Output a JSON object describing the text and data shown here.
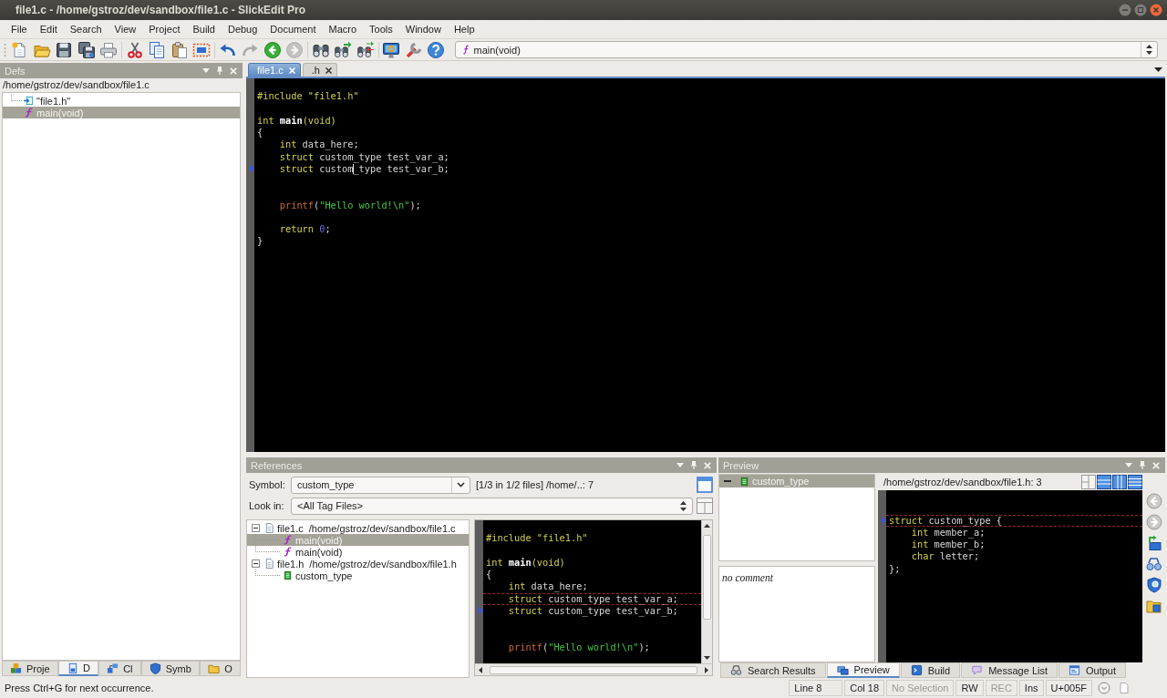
{
  "window": {
    "title": "file1.c - /home/gstroz/dev/sandbox/file1.c - SlickEdit Pro"
  },
  "menu": [
    "File",
    "Edit",
    "Search",
    "View",
    "Project",
    "Build",
    "Debug",
    "Document",
    "Macro",
    "Tools",
    "Window",
    "Help"
  ],
  "toolbar_groups": [
    [
      {
        "kind": "new",
        "disabled": false
      },
      {
        "kind": "open",
        "disabled": false
      },
      {
        "kind": "save",
        "disabled": false
      },
      {
        "kind": "save-all",
        "disabled": false
      },
      {
        "kind": "print",
        "disabled": false
      }
    ],
    [
      {
        "kind": "cut",
        "disabled": false
      },
      {
        "kind": "copy",
        "disabled": false
      },
      {
        "kind": "paste",
        "disabled": false
      },
      {
        "kind": "select",
        "disabled": false
      }
    ],
    [
      {
        "kind": "undo",
        "disabled": false
      },
      {
        "kind": "redo",
        "disabled": true
      },
      {
        "kind": "back",
        "disabled": false
      },
      {
        "kind": "forward",
        "disabled": true
      }
    ],
    [
      {
        "kind": "find",
        "disabled": false
      },
      {
        "kind": "find-next",
        "disabled": false
      },
      {
        "kind": "replace",
        "disabled": false
      }
    ],
    [
      {
        "kind": "monitor",
        "disabled": false
      },
      {
        "kind": "tools",
        "disabled": false
      },
      {
        "kind": "help",
        "disabled": false
      }
    ]
  ],
  "context_combo": {
    "value": "main(void)"
  },
  "defs_panel": {
    "title": "Defs",
    "path": "/home/gstroz/dev/sandbox/file1.c",
    "items": [
      {
        "label": "\"file1.h\"",
        "kind": "include",
        "selected": false
      },
      {
        "label": "main(void)",
        "kind": "function",
        "selected": true
      }
    ],
    "tabs": [
      {
        "label": "Proje",
        "kind": "projects",
        "selected": false
      },
      {
        "label": "D",
        "kind": "defs",
        "selected": true
      },
      {
        "label": "Cl",
        "kind": "classes",
        "selected": false
      },
      {
        "label": "Symb",
        "kind": "symbols",
        "selected": false
      },
      {
        "label": "O",
        "kind": "open",
        "selected": false
      }
    ]
  },
  "editor": {
    "tabs": [
      {
        "label": "file1.c",
        "selected": true
      },
      {
        "label": ".h",
        "selected": false
      }
    ],
    "lines": [
      {
        "marked": false,
        "current": false
      },
      {
        "marked": false,
        "current": false,
        "indented": false,
        "tokens": [
          {
            "kind": "preprocessor",
            "text": "#include \"file1.h\""
          }
        ]
      },
      {
        "marked": false,
        "current": false
      },
      {
        "marked": false,
        "current": false,
        "indented": false,
        "tokens": [
          {
            "kind": "keyword",
            "text": "int "
          },
          {
            "kind": "function",
            "text": "main"
          },
          {
            "kind": "keyword",
            "text": "(void)"
          }
        ]
      },
      {
        "marked": false,
        "current": false,
        "indented": false,
        "tokens": [
          {
            "kind": "plain",
            "text": "{"
          }
        ]
      },
      {
        "marked": false,
        "current": false,
        "indented": true,
        "tokens": [
          {
            "kind": "keyword",
            "text": "int"
          },
          {
            "kind": "plain",
            "text": " data_here;"
          }
        ]
      },
      {
        "marked": false,
        "current": false,
        "indented": true,
        "tokens": [
          {
            "kind": "keyword",
            "text": "struct"
          },
          {
            "kind": "plain",
            "text": " custom_type test_var_a;"
          }
        ]
      },
      {
        "marked": true,
        "current": false,
        "indented": true,
        "tokens": [
          {
            "kind": "keyword",
            "text": "struct"
          },
          {
            "kind": "plain",
            "text": " custom"
          },
          {
            "kind": "caret"
          },
          {
            "kind": "plain",
            "text": "_type test_var_b;"
          }
        ]
      },
      {
        "marked": false,
        "current": false
      },
      {
        "marked": false,
        "current": false
      },
      {
        "marked": false,
        "current": false,
        "indented": true,
        "tokens": [
          {
            "kind": "call",
            "text": "printf"
          },
          {
            "kind": "plain",
            "text": "("
          },
          {
            "kind": "string",
            "text": "\"Hello world!\\n\""
          },
          {
            "kind": "plain",
            "text": ");"
          }
        ]
      },
      {
        "marked": false,
        "current": false
      },
      {
        "marked": false,
        "current": false,
        "indented": true,
        "tokens": [
          {
            "kind": "keyword",
            "text": "return "
          },
          {
            "kind": "number",
            "text": "0"
          },
          {
            "kind": "plain",
            "text": ";"
          }
        ]
      },
      {
        "marked": false,
        "current": false,
        "indented": false,
        "tokens": [
          {
            "kind": "plain",
            "text": "}"
          }
        ]
      }
    ]
  },
  "references": {
    "title": "References",
    "symbol_label": "Symbol:",
    "symbol": "custom_type",
    "match_info": "[1/3 in 1/2 files] /home/..: 7",
    "look_in_label": "Look in:",
    "look_in": "<All Tag Files>",
    "tree": [
      {
        "label": "file1.c",
        "path": "/home/gstroz/dev/sandbox/file1.c",
        "kind": "file",
        "selected": false,
        "expanded": true,
        "children": [
          {
            "label": "main(void)",
            "kind": "function",
            "selected": true
          },
          {
            "label": "main(void)",
            "kind": "function",
            "selected": false
          }
        ]
      },
      {
        "label": "file1.h",
        "path": "/home/gstroz/dev/sandbox/file1.h",
        "kind": "file",
        "selected": false,
        "expanded": true,
        "children": [
          {
            "label": "custom_type",
            "kind": "struct",
            "selected": false
          }
        ]
      }
    ],
    "lines": [
      {
        "marked": false,
        "current": false
      },
      {
        "marked": false,
        "current": false,
        "indented": false,
        "tokens": [
          {
            "kind": "preprocessor",
            "text": "#include \"file1.h\""
          }
        ]
      },
      {
        "marked": false,
        "current": false
      },
      {
        "marked": false,
        "current": false,
        "indented": false,
        "tokens": [
          {
            "kind": "keyword",
            "text": "int "
          },
          {
            "kind": "function",
            "text": "main"
          },
          {
            "kind": "keyword",
            "text": "(void)"
          }
        ]
      },
      {
        "marked": false,
        "current": false,
        "indented": false,
        "tokens": [
          {
            "kind": "plain",
            "text": "{"
          }
        ]
      },
      {
        "marked": false,
        "current": false,
        "indented": true,
        "tokens": [
          {
            "kind": "keyword",
            "text": "int"
          },
          {
            "kind": "plain",
            "text": " data_here;"
          }
        ]
      },
      {
        "marked": false,
        "current": true,
        "indented": true,
        "tokens": [
          {
            "kind": "keyword",
            "text": "struct"
          },
          {
            "kind": "plain",
            "text": " custom_type test_var_a;"
          }
        ]
      },
      {
        "marked": true,
        "current": false,
        "indented": true,
        "tokens": [
          {
            "kind": "keyword",
            "text": "struct"
          },
          {
            "kind": "plain",
            "text": " custom_type test_var_b;"
          }
        ]
      },
      {
        "marked": false,
        "current": false
      },
      {
        "marked": false,
        "current": false
      },
      {
        "marked": false,
        "current": false,
        "indented": true,
        "tokens": [
          {
            "kind": "call",
            "text": "printf"
          },
          {
            "kind": "plain",
            "text": "("
          },
          {
            "kind": "string",
            "text": "\"Hello world!\\n\""
          },
          {
            "kind": "plain",
            "text": ");"
          }
        ]
      }
    ]
  },
  "preview": {
    "title": "Preview",
    "tree": [
      {
        "label": "custom_type",
        "kind": "struct",
        "selected": true,
        "expanded": true
      }
    ],
    "comment": "no comment",
    "path": "/home/gstroz/dev/sandbox/file1.h: 3",
    "lines": [
      {
        "marked": false,
        "current": false
      },
      {
        "marked": false,
        "current": false
      },
      {
        "marked": true,
        "current": true,
        "indented": false,
        "tokens": [
          {
            "kind": "keyword",
            "text": "struct"
          },
          {
            "kind": "plain",
            "text": " custom_type {"
          }
        ]
      },
      {
        "marked": false,
        "current": false,
        "indented": true,
        "tokens": [
          {
            "kind": "keyword",
            "text": "int"
          },
          {
            "kind": "plain",
            "text": " member_a;"
          }
        ]
      },
      {
        "marked": false,
        "current": false,
        "indented": true,
        "tokens": [
          {
            "kind": "keyword",
            "text": "int"
          },
          {
            "kind": "plain",
            "text": " member_b;"
          }
        ]
      },
      {
        "marked": false,
        "current": false,
        "indented": true,
        "tokens": [
          {
            "kind": "keyword",
            "text": "char"
          },
          {
            "kind": "plain",
            "text": " letter;"
          }
        ]
      },
      {
        "marked": false,
        "current": false,
        "indented": false,
        "tokens": [
          {
            "kind": "plain",
            "text": "};"
          }
        ]
      }
    ]
  },
  "bottom_tabs": [
    {
      "label": "Search Results",
      "kind": "search",
      "selected": false
    },
    {
      "label": "Preview",
      "kind": "preview",
      "selected": true
    },
    {
      "label": "Build",
      "kind": "build",
      "selected": false
    },
    {
      "label": "Message List",
      "kind": "messages",
      "selected": false
    },
    {
      "label": "Output",
      "kind": "output",
      "selected": false
    }
  ],
  "status_bar": {
    "message": "Press Ctrl+G for next occurrence.",
    "fields": [
      {
        "text": "Line 8",
        "disabled": false
      },
      {
        "text": "Col 18",
        "disabled": false
      },
      {
        "text": "No Selection",
        "disabled": true
      },
      {
        "text": "RW",
        "disabled": false
      },
      {
        "text": "REC",
        "disabled": true
      },
      {
        "text": "Ins",
        "disabled": false
      },
      {
        "text": "U+005F",
        "disabled": false
      }
    ]
  }
}
